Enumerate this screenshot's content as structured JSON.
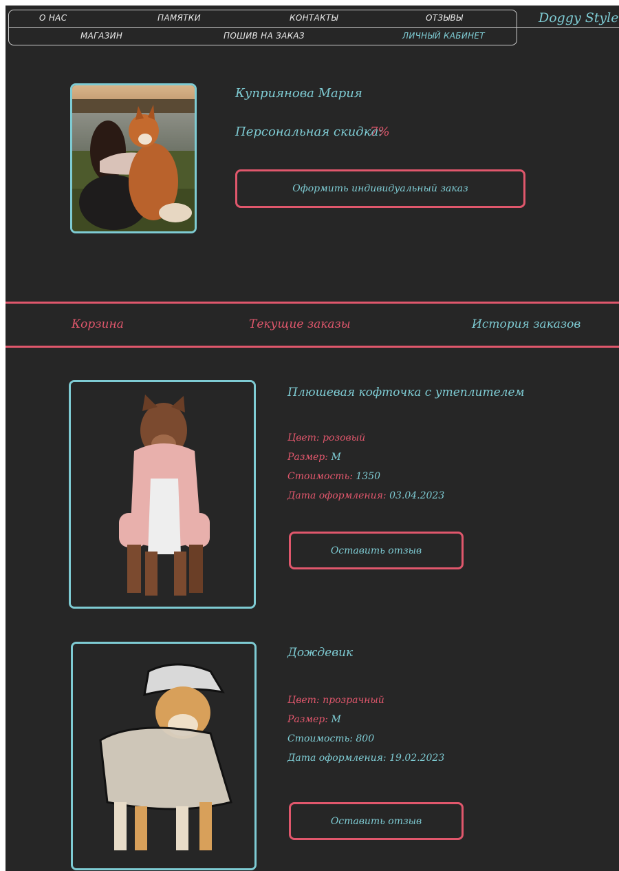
{
  "nav": {
    "row1": [
      "О НАС",
      "ПАМЯТКИ",
      "КОНТАКТЫ",
      "ОТЗЫВЫ"
    ],
    "row2": [
      "МАГАЗИН",
      "ПОШИВ НА ЗАКАЗ",
      "ЛИЧНЫЙ КАБИНЕТ"
    ],
    "active": "ЛИЧНЫЙ КАБИНЕТ"
  },
  "brand": "Doggy Style",
  "profile": {
    "name": "Куприянова Мария",
    "discount_label": "Персональная скидка:",
    "discount_value": "7%",
    "order_button": "Оформить индивидуальный заказ"
  },
  "tabs": [
    "Корзина",
    "Текущие заказы",
    "История заказов"
  ],
  "orders": [
    {
      "title": "Плюшевая кофточка с утеплителем",
      "color_label": "Цвет:",
      "color_value": "розовый",
      "size_label": "Размер:",
      "size_value": "M",
      "price_label": "Стоимость:",
      "price_value": "1350",
      "date_label": "Дата оформления:",
      "date_value": "03.04.2023",
      "review_button": "Оставить отзыв"
    },
    {
      "title": "Дождевик",
      "color_label": "Цвет:",
      "color_value": "прозрачный",
      "size_label": "Размер:",
      "size_value": "M",
      "price_label": "Стоимость:",
      "price_value": "800",
      "date_label": "Дата оформления:",
      "date_value": "19.02.2023",
      "review_button": "Оставить отзыв"
    }
  ],
  "colors": {
    "background": "#262626",
    "accent_cyan": "#7ecbd3",
    "accent_pink": "#e0576c",
    "nav_text": "#e8e8e8"
  }
}
